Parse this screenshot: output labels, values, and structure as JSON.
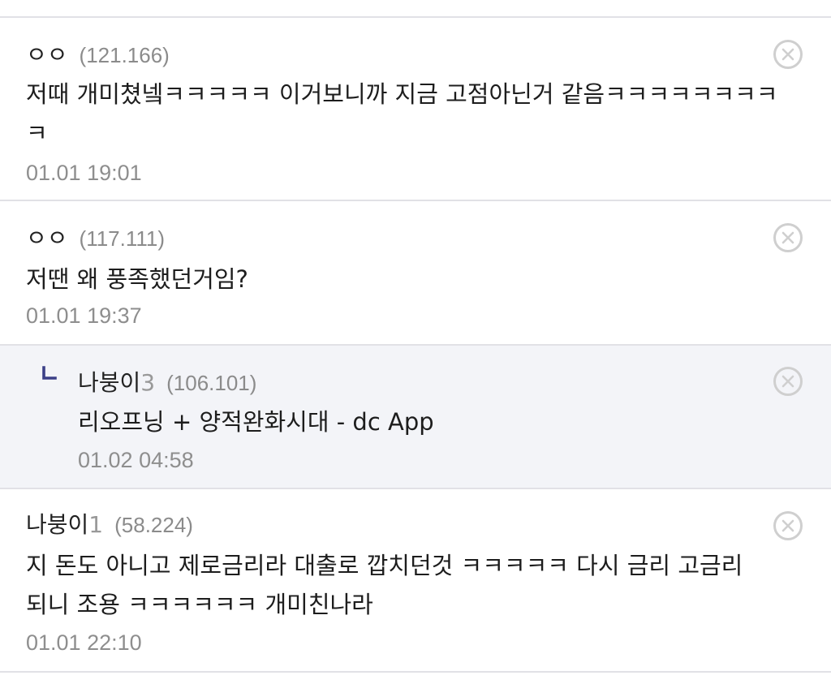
{
  "comments": [
    {
      "nick": "ㅇㅇ",
      "nick_suffix": "",
      "ip": "(121.166)",
      "text": "저때 개미쳤넼ㅋㅋㅋㅋㅋ 이거보니까 지금 고점아닌거 같음ㅋㅋㅋㅋㅋㅋㅋㅋ",
      "text_line2": "ㅋ",
      "date": "01.01 19:01"
    },
    {
      "nick": "ㅇㅇ",
      "nick_suffix": "",
      "ip": "(117.111)",
      "text": "저땐 왜 풍족했던거임?",
      "date": "01.01 19:37"
    },
    {
      "nick": "나붕이",
      "nick_suffix": "3",
      "ip": "(106.101)",
      "text": "리오프닝 + 양적완화시대 - dc App",
      "date": "01.02 04:58",
      "is_reply": true
    },
    {
      "nick": "나붕이",
      "nick_suffix": "1",
      "ip": "(58.224)",
      "text": "지 돈도 아니고 제로금리라 대출로 깝치던것 ㅋㅋㅋㅋㅋ 다시 금리 고금리",
      "text_line2": "되니 조용 ㅋㅋㅋㅋㅋㅋ 개미친나라",
      "date": "01.01 22:10"
    }
  ],
  "icons": {
    "delete": "close-circle-icon",
    "reply": "reply-arrow-icon"
  },
  "colors": {
    "reply_bg": "#f3f4f8",
    "reply_mark": "#3b3f87",
    "meta": "#8e8e8e"
  }
}
